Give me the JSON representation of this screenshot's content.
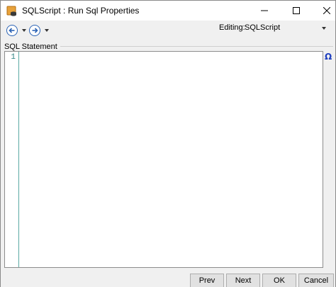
{
  "window": {
    "title": "SQLScript : Run Sql Properties"
  },
  "toolbar": {
    "back_icon": "arrow-left-circle-icon",
    "forward_icon": "arrow-right-circle-icon",
    "editing_label": "Editing:",
    "editing_value": "SQLScript"
  },
  "group": {
    "label": "SQL Statement"
  },
  "editor": {
    "line_numbers": [
      "1"
    ],
    "content": "",
    "special_char_button": "Ω"
  },
  "buttons": {
    "prev": "Prev",
    "next": "Next",
    "ok": "OK",
    "cancel": "Cancel"
  },
  "colors": {
    "nav_accent": "#2b63b5",
    "gutter_line": "#5aa9a3",
    "line_number": "#2a8080",
    "omega": "#1f3fbf"
  }
}
